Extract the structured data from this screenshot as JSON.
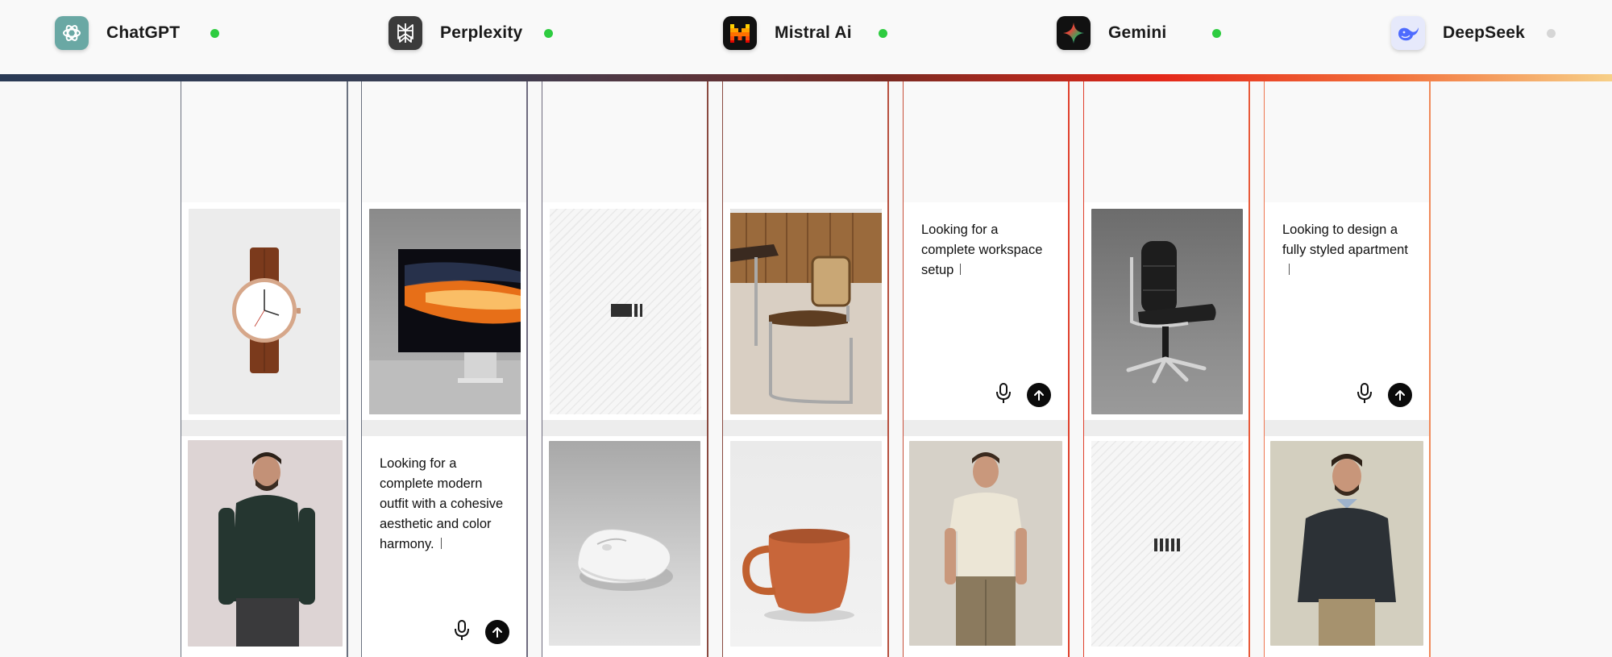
{
  "providers": [
    {
      "name": "ChatGPT",
      "status": "online",
      "status_color": "#2ecc40",
      "icon": "chatgpt-logo-icon",
      "logo_bg": "#6aa8a4"
    },
    {
      "name": "Perplexity",
      "status": "online",
      "status_color": "#2ecc40",
      "icon": "perplexity-logo-icon",
      "logo_bg": "#3b3b3b"
    },
    {
      "name": "Mistral Ai",
      "status": "online",
      "status_color": "#2ecc40",
      "icon": "mistral-logo-icon",
      "logo_bg": "#111111"
    },
    {
      "name": "Gemini",
      "status": "online",
      "status_color": "#2ecc40",
      "icon": "gemini-logo-icon",
      "logo_bg": "#111111"
    },
    {
      "name": "DeepSeek",
      "status": "offline",
      "status_color": "#d6d6d6",
      "icon": "deepseek-logo-icon",
      "logo_bg": "#e6e9fb"
    }
  ],
  "columns": [
    {
      "top": {
        "type": "image",
        "subject": "wristwatch"
      },
      "bottom": {
        "type": "image",
        "subject": "man-dark-sweater"
      }
    },
    {
      "top": {
        "type": "image",
        "subject": "monitor"
      },
      "bottom": {
        "type": "prompt",
        "text": "Looking for a complete modern outfit with a cohesive aesthetic and color harmony."
      }
    },
    {
      "top": {
        "type": "loading",
        "icon": "loading-bars-icon"
      },
      "bottom": {
        "type": "image",
        "subject": "computer-mouse"
      }
    },
    {
      "top": {
        "type": "image",
        "subject": "cane-chair"
      },
      "bottom": {
        "type": "image",
        "subject": "orange-mug"
      }
    },
    {
      "top": {
        "type": "prompt",
        "text": "Looking for a complete workspace setup"
      },
      "bottom": {
        "type": "image",
        "subject": "man-cream-tshirt"
      }
    },
    {
      "top": {
        "type": "image",
        "subject": "office-chair"
      },
      "bottom": {
        "type": "loading",
        "icon": "loading-bars-icon"
      }
    },
    {
      "top": {
        "type": "prompt",
        "text": "Looking to design a fully styled apartment"
      },
      "bottom": {
        "type": "image",
        "subject": "man-navy-sweater"
      }
    }
  ],
  "colors": {
    "gradient": [
      "#2a3a55",
      "#3b3f54",
      "#7a2a22",
      "#e4281a",
      "#f26f3a",
      "#f7d088"
    ],
    "send_button": "#0b0b0b"
  },
  "actions": {
    "mic_icon": "microphone-icon",
    "send_icon": "arrow-up-icon"
  }
}
